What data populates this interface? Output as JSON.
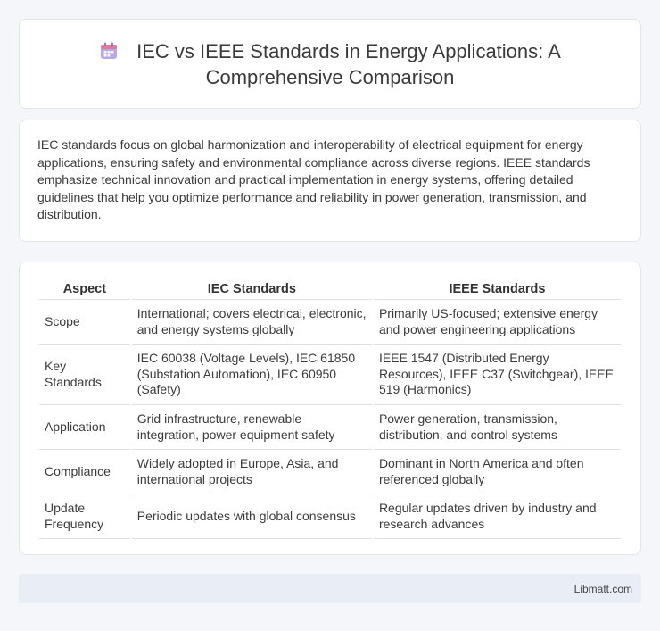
{
  "header": {
    "title": "IEC vs IEEE Standards in Energy Applications: A Comprehensive Comparison",
    "icon": "calendar-icon"
  },
  "intro": {
    "text": "IEC standards focus on global harmonization and interoperability of electrical equipment for energy applications, ensuring safety and environmental compliance across diverse regions. IEEE standards emphasize technical innovation and practical implementation in energy systems, offering detailed guidelines that help you optimize performance and reliability in power generation, transmission, and distribution."
  },
  "table": {
    "headers": [
      "Aspect",
      "IEC Standards",
      "IEEE Standards"
    ],
    "rows": [
      {
        "aspect": "Scope",
        "iec": "International; covers electrical, electronic, and energy systems globally",
        "ieee": "Primarily US-focused; extensive energy and power engineering applications"
      },
      {
        "aspect": "Key Standards",
        "iec": "IEC 60038 (Voltage Levels), IEC 61850 (Substation Automation), IEC 60950 (Safety)",
        "ieee": "IEEE 1547 (Distributed Energy Resources), IEEE C37 (Switchgear), IEEE 519 (Harmonics)"
      },
      {
        "aspect": "Application",
        "iec": "Grid infrastructure, renewable integration, power equipment safety",
        "ieee": "Power generation, transmission, distribution, and control systems"
      },
      {
        "aspect": "Compliance",
        "iec": "Widely adopted in Europe, Asia, and international projects",
        "ieee": "Dominant in North America and often referenced globally"
      },
      {
        "aspect": "Update Frequency",
        "iec": "Periodic updates with global consensus",
        "ieee": "Regular updates driven by industry and research advances"
      }
    ]
  },
  "footer": {
    "brand": "Libmatt.com"
  },
  "colors": {
    "background": "#f4f6f9",
    "footer_bg": "#e8edf6",
    "icon_top": "#e07a9a",
    "icon_body": "#b9a6e6"
  }
}
